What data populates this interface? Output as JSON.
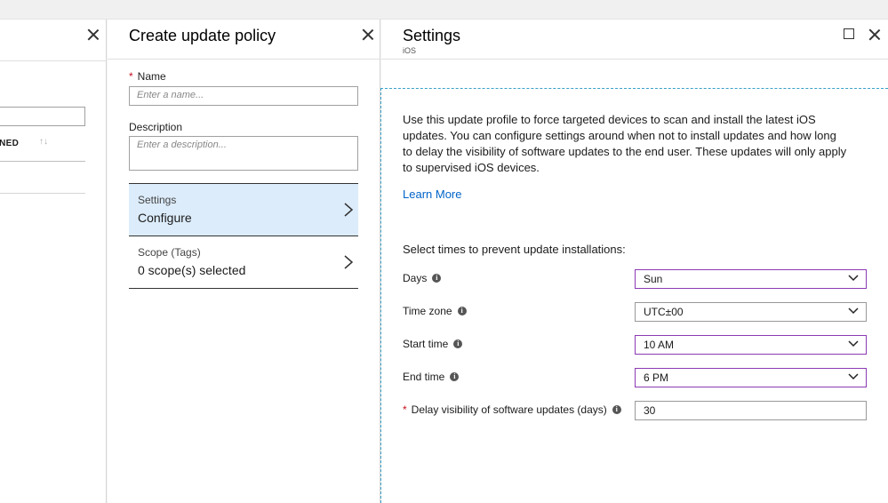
{
  "left_blade": {
    "column_header": "GNED",
    "sort_glyph": "↑↓"
  },
  "policy_blade": {
    "title": "Create update policy",
    "name": {
      "label": "Name",
      "placeholder": "Enter a name..."
    },
    "description": {
      "label": "Description",
      "placeholder": "Enter a description..."
    },
    "nav": [
      {
        "title": "Settings",
        "value": "Configure"
      },
      {
        "title": "Scope (Tags)",
        "value": "0 scope(s) selected"
      }
    ]
  },
  "settings_blade": {
    "title": "Settings",
    "subtitle": "iOS",
    "description": "Use this update profile to force targeted devices to scan and install the latest iOS updates. You can configure settings around when not to install updates and how long to delay the visibility of software updates to the end user. These updates will only apply to supervised iOS devices.",
    "learn_more": "Learn More",
    "section_heading": "Select times to prevent update installations:",
    "fields": {
      "days": {
        "label": "Days",
        "value": "Sun"
      },
      "time_zone": {
        "label": "Time zone",
        "value": "UTC±00"
      },
      "start_time": {
        "label": "Start time",
        "value": "10 AM"
      },
      "end_time": {
        "label": "End time",
        "value": "6 PM"
      },
      "delay": {
        "label": "Delay visibility of software updates (days)",
        "value": "30"
      }
    }
  },
  "icons": {
    "close": "close-icon",
    "maximize": "maximize-icon",
    "chevron_right": "chevron-right-icon",
    "chevron_down": "chevron-down-icon",
    "info": "info-icon"
  },
  "colors": {
    "accent_link": "#0064c8",
    "selected_row": "#dcecfb",
    "focus_border": "#8c3ab4",
    "required": "#c50f1f"
  }
}
